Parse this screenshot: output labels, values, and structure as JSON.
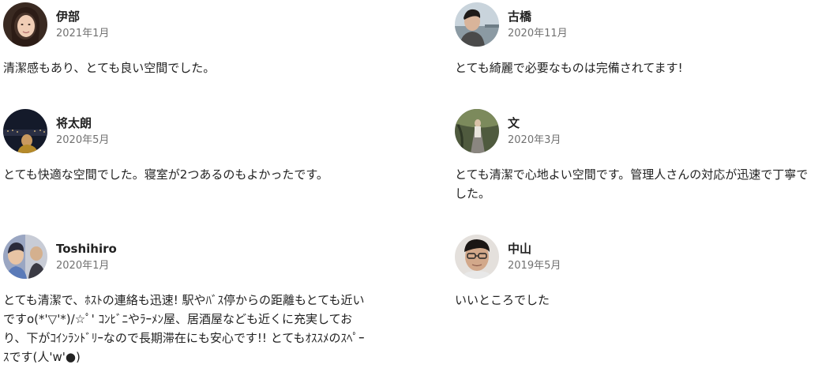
{
  "reviews": [
    {
      "name": "伊部",
      "date": "2021年1月",
      "text": "清潔感もあり、とても良い空間でした。"
    },
    {
      "name": "古橋",
      "date": "2020年11月",
      "text": "とても綺麗で必要なものは完備されてます!"
    },
    {
      "name": "将太朗",
      "date": "2020年5月",
      "text": "とても快適な空間でした。寝室が2つあるのもよかったです。"
    },
    {
      "name": "文",
      "date": "2020年3月",
      "text": "とても清潔で心地よい空間です。管理人さんの対応が迅速で丁寧でした。"
    },
    {
      "name": "Toshihiro",
      "date": "2020年1月",
      "text": "とても清潔で、ﾎｽﾄの連絡も迅速! 駅やﾊﾞｽ停からの距離もとても近いですo(*'▽'*)/☆ﾟ' ｺﾝﾋﾞﾆやﾗｰﾒﾝ屋、居酒屋なども近くに充実しており、下がｺｲﾝﾗﾝﾄﾞﾘｰなので長期滞在にも安心です!! とてもｵｽｽﾒのｽﾍﾟｰｽです(人'w'●)"
    },
    {
      "name": "中山",
      "date": "2019年5月",
      "text": "いいところでした"
    }
  ]
}
